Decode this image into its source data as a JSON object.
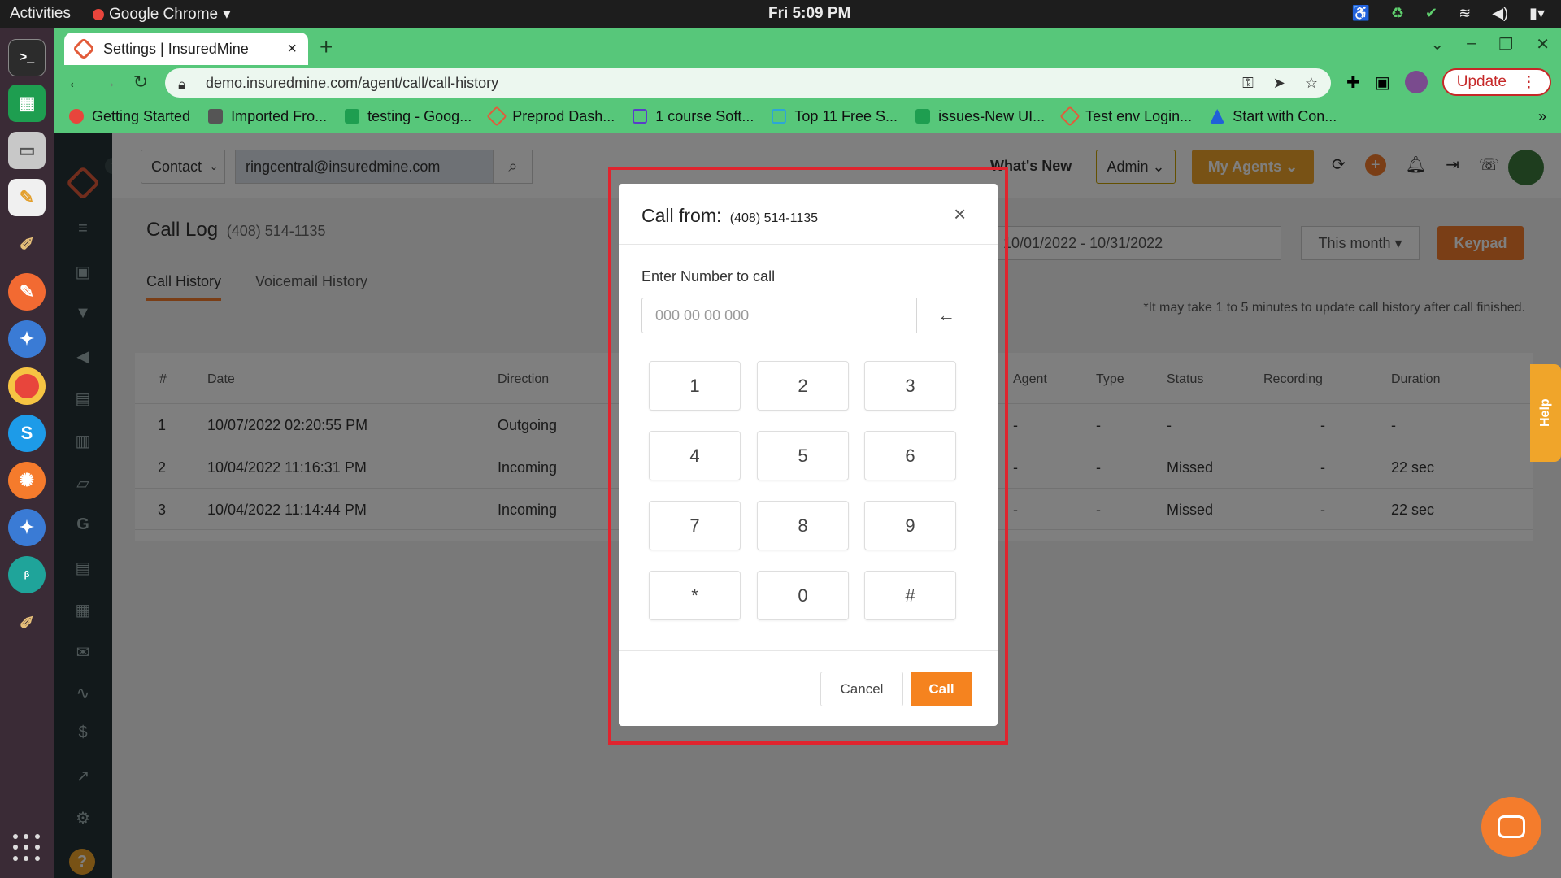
{
  "os": {
    "activities": "Activities",
    "app_name": "Google Chrome",
    "clock": "Fri  5:09 PM"
  },
  "browser": {
    "tab_title": "Settings | InsuredMine",
    "url": "demo.insuredmine.com/agent/call/call-history",
    "update_label": "Update",
    "bookmarks": [
      {
        "label": "Getting Started"
      },
      {
        "label": "Imported Fro..."
      },
      {
        "label": "testing - Goog..."
      },
      {
        "label": "Preprod Dash..."
      },
      {
        "label": "1 course Soft..."
      },
      {
        "label": "Top 11 Free S..."
      },
      {
        "label": "issues-New UI..."
      },
      {
        "label": "Test env Login..."
      },
      {
        "label": "Start with Con..."
      }
    ]
  },
  "header": {
    "contact_label": "Contact",
    "search_value": "ringcentral@insuredmine.com",
    "whats_new": "What's New",
    "admin_label": "Admin",
    "my_agents_label": "My Agents"
  },
  "page": {
    "title": "Call Log",
    "phone": "(408) 514-1135",
    "tabs": [
      {
        "label": "Call History"
      },
      {
        "label": "Voicemail History"
      }
    ],
    "date_range": "10/01/2022 - 10/31/2022",
    "range_select": "This month",
    "keypad_label": "Keypad",
    "note": "*It may take 1 to 5 minutes to update call history after call finished."
  },
  "table": {
    "headers": [
      "#",
      "Date",
      "Direction",
      "Agent",
      "Type",
      "Status",
      "Recording",
      "Duration"
    ],
    "rows": [
      {
        "num": "1",
        "date": "10/07/2022 02:20:55 PM",
        "direction": "Outgoing",
        "agent": "-",
        "type": "-",
        "status": "-",
        "recording": "-",
        "duration": "-"
      },
      {
        "num": "2",
        "date": "10/04/2022 11:16:31 PM",
        "direction": "Incoming",
        "agent": "-",
        "type": "-",
        "status": "Missed",
        "recording": "-",
        "duration": "22 sec"
      },
      {
        "num": "3",
        "date": "10/04/2022 11:14:44 PM",
        "direction": "Incoming",
        "agent": "-",
        "type": "-",
        "status": "Missed",
        "recording": "-",
        "duration": "22 sec"
      }
    ]
  },
  "help_label": "Help",
  "modal": {
    "title": "Call from:",
    "from_number": "(408) 514-1135",
    "input_label": "Enter Number to call",
    "input_placeholder": "000 00 00 000",
    "keys": [
      "1",
      "2",
      "3",
      "4",
      "5",
      "6",
      "7",
      "8",
      "9",
      "*",
      "0",
      "#"
    ],
    "cancel_label": "Cancel",
    "call_label": "Call"
  },
  "colors": {
    "accent_orange": "#f47c2c",
    "highlight_red": "#e0242e",
    "chrome_green": "#57c77a"
  }
}
